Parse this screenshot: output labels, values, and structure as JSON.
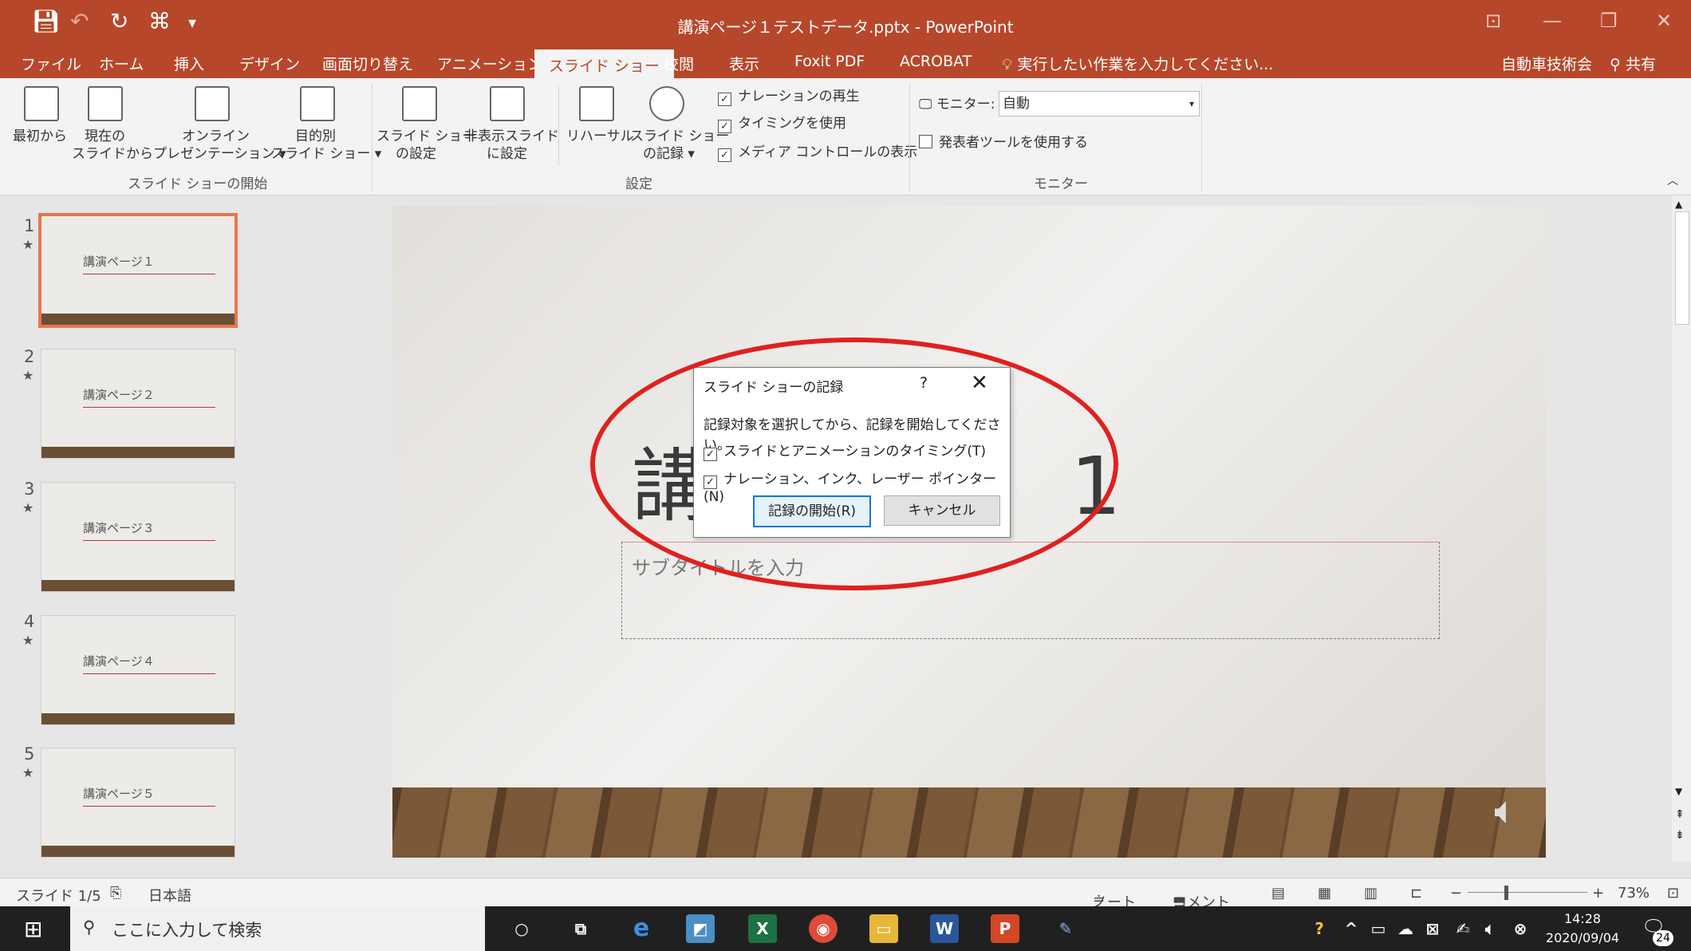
{
  "titlebar": {
    "title": "講演ページ１テストデータ.pptx - PowerPoint",
    "qat": {
      "save_icon": "save-icon",
      "undo_icon": "undo-icon",
      "redo_icon": "redo-icon",
      "present_icon": "present-icon",
      "more_icon": "customize-icon"
    },
    "window_buttons": {
      "ribbon_options": "⊡",
      "minimize": "—",
      "restore": "❐",
      "close": "✕"
    }
  },
  "tabs": [
    {
      "label": "ファイル"
    },
    {
      "label": "ホーム"
    },
    {
      "label": "挿入"
    },
    {
      "label": "デザイン"
    },
    {
      "label": "画面切り替え"
    },
    {
      "label": "アニメーション"
    },
    {
      "label": "スライド ショー"
    },
    {
      "label": "校閲"
    },
    {
      "label": "表示"
    },
    {
      "label": "Foxit PDF"
    },
    {
      "label": "ACROBAT"
    }
  ],
  "tell_me": "実行したい作業を入力してください...",
  "account": {
    "name": "自動車技術会",
    "share": "共有"
  },
  "ribbon": {
    "start": {
      "from_beginning": "最初から",
      "from_current_1": "現在の",
      "from_current_2": "スライドから",
      "online_1": "オンライン",
      "online_2": "プレゼンテーション ▾",
      "custom_1": "目的別",
      "custom_2": "スライド ショー ▾",
      "group": "スライド ショーの開始"
    },
    "setup": {
      "setup_1": "スライド ショー",
      "setup_2": "の設定",
      "hide_1": "非表示スライド",
      "hide_2": "に設定",
      "rehearse": "リハーサル",
      "record_1": "スライド ショー",
      "record_2": "の記録 ▾",
      "play_narrations": "ナレーションの再生",
      "use_timings": "タイミングを使用",
      "show_media_controls": "メディア コントロールの表示",
      "group": "設定"
    },
    "monitors": {
      "monitor_label": "モニター:",
      "monitor_value": "自動",
      "presenter_view": "発表者ツールを使用する",
      "group": "モニター"
    }
  },
  "thumbnails": [
    {
      "num": "1",
      "title": "講演ページ１"
    },
    {
      "num": "2",
      "title": "講演ページ２"
    },
    {
      "num": "3",
      "title": "講演ページ３"
    },
    {
      "num": "4",
      "title": "講演ページ４"
    },
    {
      "num": "5",
      "title": "講演ページ５"
    }
  ],
  "slide": {
    "title_left": "講",
    "title_right": "1",
    "subtitle_placeholder": "サブタイトルを入力"
  },
  "dialog": {
    "title": "スライド ショーの記録",
    "help": "?",
    "close": "✕",
    "message": "記録対象を選択してから、記録を開始してください。",
    "option_timings": "スライドとアニメーションのタイミング(T)",
    "option_narration": "ナレーション、インク、レーザー ポインター (N)",
    "start_button": "記録の開始(R)",
    "cancel_button": "キャンセル"
  },
  "status": {
    "slide_count": "スライド 1/5",
    "language": "日本語",
    "notes": "ノート",
    "comments": "コメント",
    "zoom": "73%"
  },
  "taskbar": {
    "search_placeholder": "ここに入力して検索",
    "time": "14:28",
    "date": "2020/09/04",
    "notification_count": "24"
  },
  "colors": {
    "accent": "#b7472a",
    "highlight": "#e02020",
    "selection": "#e7764f"
  }
}
